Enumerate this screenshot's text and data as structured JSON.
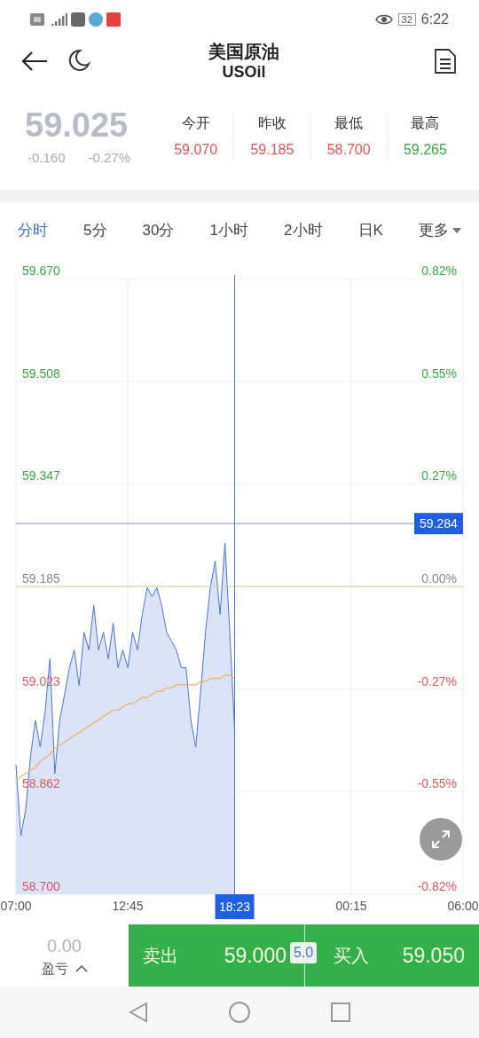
{
  "status_bar": {
    "battery": "32",
    "time": "6:22"
  },
  "header": {
    "title": "美国原油",
    "subtitle": "USOil"
  },
  "quote": {
    "price": "59.025",
    "change": "-0.160",
    "change_pct": "-0.27%",
    "stats": [
      {
        "label": "今开",
        "value": "59.070",
        "color": "#e0575c"
      },
      {
        "label": "昨收",
        "value": "59.185",
        "color": "#e0575c"
      },
      {
        "label": "最低",
        "value": "58.700",
        "color": "#e0575c"
      },
      {
        "label": "最高",
        "value": "59.265",
        "color": "#3aa845"
      }
    ]
  },
  "tabs": [
    {
      "label": "分时",
      "selected": true,
      "kind": "tab"
    },
    {
      "label": "5分",
      "selected": false,
      "kind": "tab"
    },
    {
      "label": "30分",
      "selected": false,
      "kind": "tab"
    },
    {
      "label": "1小时",
      "selected": false,
      "kind": "tab"
    },
    {
      "label": "2小时",
      "selected": false,
      "kind": "tab"
    },
    {
      "label": "日K",
      "selected": false,
      "kind": "tab"
    },
    {
      "label": "更多",
      "selected": false,
      "kind": "dropdown"
    }
  ],
  "chart": {
    "crosshair_time": "18:23",
    "percent_labels": [
      "0.82%",
      "0.55%",
      "0.27%",
      "0.00%",
      "-0.27%",
      "-0.55%",
      "-0.82%"
    ],
    "chart_data": {
      "type": "area",
      "categories": [
        "07:00",
        null,
        null,
        null,
        null,
        null,
        null,
        null,
        null,
        null,
        null,
        null,
        null,
        null,
        null,
        null,
        null,
        null,
        null,
        null,
        null,
        null,
        null,
        "12:45",
        null,
        null,
        null,
        null,
        null,
        null,
        null,
        null,
        null,
        null,
        null,
        null,
        null,
        null,
        null,
        null,
        null,
        null,
        null,
        null,
        null,
        null,
        null,
        null,
        null,
        null,
        null,
        null,
        null,
        null,
        null,
        null,
        null,
        null,
        null,
        null,
        null,
        null,
        null,
        null,
        null,
        null,
        null,
        null,
        null,
        "00:15",
        null,
        null,
        null,
        null,
        null,
        null,
        null,
        null,
        null,
        null,
        null,
        null,
        null,
        null,
        null,
        null,
        null,
        null,
        null,
        null,
        null,
        null,
        "06:00"
      ],
      "series": [
        {
          "type": "area",
          "color": "#4a72d8",
          "values": [
            58.904,
            58.792,
            58.834,
            58.918,
            58.974,
            58.932,
            58.988,
            59.071,
            58.89,
            58.974,
            59.015,
            59.057,
            59.085,
            59.029,
            59.113,
            59.085,
            59.155,
            59.085,
            59.113,
            59.071,
            59.127,
            59.057,
            59.085,
            59.057,
            59.113,
            59.085,
            59.141,
            59.183,
            59.169,
            59.183,
            59.155,
            59.113,
            59.099,
            59.085,
            59.057,
            59.057,
            58.974,
            58.932,
            59.02,
            59.113,
            59.183,
            59.225,
            59.141,
            59.253,
            59.113,
            58.96,
            null,
            null,
            null,
            null,
            null,
            null,
            null,
            null,
            null,
            null,
            null,
            null,
            null,
            null,
            null,
            null,
            null,
            null,
            null,
            null,
            null,
            null,
            null,
            null,
            null,
            null,
            null,
            null,
            null,
            null,
            null,
            null,
            null,
            null,
            null,
            null,
            null,
            null,
            null,
            null,
            null,
            null,
            null,
            null,
            null,
            null,
            null
          ]
        },
        {
          "type": "line",
          "color": "#f0b060",
          "values": [
            58.88,
            58.885,
            58.89,
            58.895,
            58.9,
            58.91,
            58.915,
            58.92,
            58.93,
            58.935,
            58.94,
            58.945,
            58.95,
            58.955,
            58.96,
            58.965,
            58.97,
            58.975,
            58.98,
            58.985,
            58.99,
            58.99,
            58.995,
            59.0,
            59.0,
            59.005,
            59.01,
            59.01,
            59.015,
            59.02,
            59.02,
            59.025,
            59.025,
            59.03,
            59.03,
            59.03,
            59.03,
            59.03,
            59.035,
            59.035,
            59.04,
            59.04,
            59.04,
            59.045,
            59.045,
            59.04,
            null,
            null,
            null,
            null,
            null,
            null,
            null,
            null,
            null,
            null,
            null,
            null,
            null,
            null,
            null,
            null,
            null,
            null,
            null,
            null,
            null,
            null,
            null,
            null,
            null,
            null,
            null,
            null,
            null,
            null,
            null,
            null,
            null,
            null,
            null,
            null,
            null,
            null,
            null,
            null,
            null,
            null,
            null,
            null,
            null,
            null,
            null
          ]
        }
      ],
      "ylim": [
        58.7,
        59.67
      ],
      "grid": true,
      "ref_lines": [
        {
          "axis": "y",
          "value": 59.185
        },
        {
          "axis": "y",
          "value": 59.284,
          "label": "59.284"
        }
      ],
      "yticks": [
        {
          "value": 59.67,
          "label": "59.670"
        },
        {
          "value": 59.508,
          "label": "59.508"
        },
        {
          "value": 59.347,
          "label": "59.347"
        },
        {
          "value": 59.185,
          "label": "59.185"
        },
        {
          "value": 59.023,
          "label": "59.023"
        },
        {
          "value": 58.862,
          "label": "58.862"
        },
        {
          "value": 58.7,
          "label": "58.700"
        }
      ]
    }
  },
  "trade": {
    "pnl": "0.00",
    "pnl_label": "盈亏",
    "sell_label": "卖出",
    "sell_price": "59.000",
    "spread": "5.0",
    "buy_label": "买入",
    "buy_price": "59.050"
  }
}
